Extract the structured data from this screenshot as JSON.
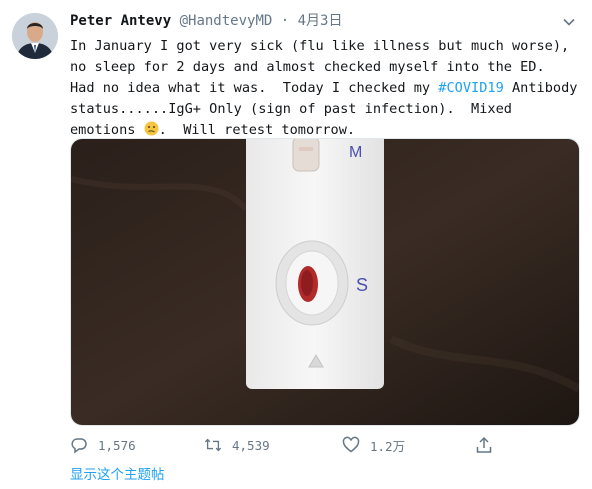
{
  "tweet": {
    "display_name": "Peter Antevy",
    "handle": "@HandtevyMD",
    "separator": "·",
    "date": "4月3日",
    "text_before_hashtag": "In January I got very sick (flu like illness but much worse), no sleep for 2 days and almost checked myself into the ED.  Had no idea what it was.  Today I checked my ",
    "hashtag": "#COVID19",
    "text_after_hashtag": " Antibody status......IgG+ Only (sign of past infection).  Mixed emotions ",
    "text_end": ".  Will retest tomorrow.",
    "emoji_icon": "confused-face-emoji"
  },
  "media": {
    "photo_labels": {
      "top": "M",
      "bottom": "S"
    }
  },
  "actions": {
    "reply_count": "1,576",
    "retweet_count": "4,539",
    "like_count": "1.2万"
  },
  "footer": {
    "show_thread": "显示这个主题帖"
  },
  "colors": {
    "link": "#1da1f2",
    "secondary_text": "#657786",
    "primary_text": "#14171a"
  }
}
